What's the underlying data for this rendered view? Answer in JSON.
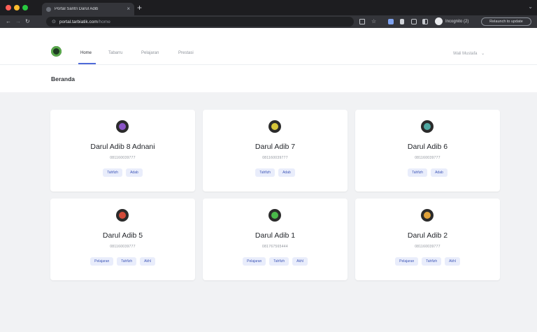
{
  "browser": {
    "tab_title": "Portal Santri Darul Adib",
    "tab_close": "×",
    "new_tab": "+",
    "url_host": "portal.tarbiatik.com",
    "url_path": "/home",
    "incognito_label": "Incognito (2)",
    "update_button": "Relaunch to update",
    "icons": [
      "back-icon",
      "forward-icon",
      "reload-icon",
      "lock-icon",
      "translate-icon",
      "star-icon",
      "extension-icon",
      "bookmark-icon",
      "screenshot-icon",
      "sidebar-icon",
      "profile-icon"
    ]
  },
  "navbar": {
    "links": [
      "Home",
      "Tabarru",
      "Pelajaran",
      "Prestasi"
    ],
    "active": "Home",
    "user": "Wali Mustafa",
    "user_chevron": "⌄"
  },
  "page": {
    "title": "Beranda"
  },
  "students": [
    {
      "name": "Darul Adib 8 Adnani",
      "phone": "081160039777",
      "tags": [
        "Tahfizh",
        "Adab"
      ],
      "color": "#8b55c7"
    },
    {
      "name": "Darul Adib 7",
      "phone": "081160039777",
      "tags": [
        "Tahfizh",
        "Adab"
      ],
      "color": "#d6c63a"
    },
    {
      "name": "Darul Adib 6",
      "phone": "081160039777",
      "tags": [
        "Tahfizh",
        "Adab"
      ],
      "color": "#4fa8a2"
    },
    {
      "name": "Darul Adib 5",
      "phone": "081160039777",
      "tags": [
        "Pelajaran",
        "Tahfizh",
        "Akhl"
      ],
      "color": "#d24b3a"
    },
    {
      "name": "Darul Adib 1",
      "phone": "081767565444",
      "tags": [
        "Pelajaran",
        "Tahfizh",
        "Akhl"
      ],
      "color": "#4ab84a"
    },
    {
      "name": "Darul Adib 2",
      "phone": "081160039777",
      "tags": [
        "Pelajaran",
        "Tahfizh",
        "Akhl"
      ],
      "color": "#e0a23a"
    }
  ]
}
